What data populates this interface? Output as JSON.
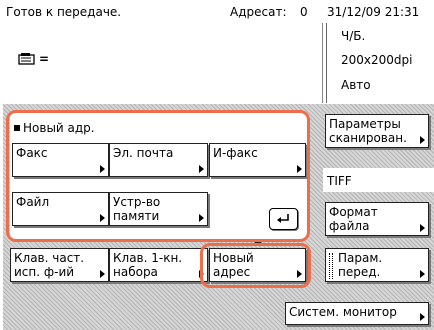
{
  "status": {
    "ready_text": "Готов к передаче.",
    "recipient_label": "Адресат:",
    "recipient_count": "0",
    "datetime": "31/12/09 21:31"
  },
  "info": {
    "memory_label": "=",
    "color_mode": "Ч/Б.",
    "resolution": "200x200dpi",
    "density": "Авто"
  },
  "dest_group": {
    "title": "Новый адр."
  },
  "buttons": {
    "fax": "Факс",
    "email": "Эл. почта",
    "ifax": "И-факс",
    "file": "Файл",
    "memory_device": [
      "Устр-во",
      "памяти"
    ],
    "scan_settings": [
      "Параметры",
      "сканирован."
    ],
    "file_type": "TIFF",
    "file_format": [
      "Формат",
      "файла"
    ],
    "freq_keys": [
      "Клав. част.",
      "исп. ф-ий"
    ],
    "one_touch": [
      "Клав. 1-кн.",
      "набора"
    ],
    "new_address": [
      "Новый",
      "адрес"
    ],
    "send_settings": [
      "Парам.",
      "перед."
    ],
    "system_monitor": "Систем. монитор"
  },
  "colors": {
    "highlight": "#ee6e4b",
    "hatch": "#d6d6d6"
  }
}
